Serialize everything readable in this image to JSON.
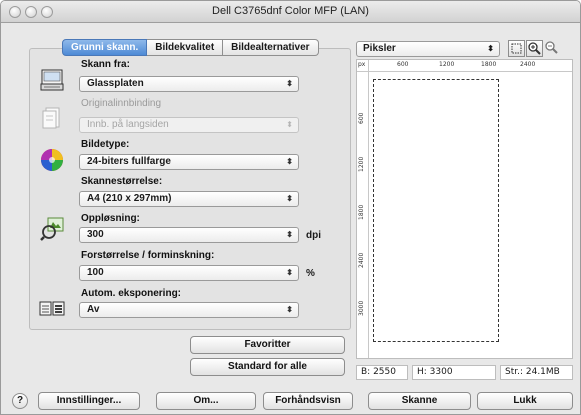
{
  "window": {
    "title": "Dell C3765dnf Color MFP (LAN)"
  },
  "tabs": [
    {
      "label": "Grunni skann."
    },
    {
      "label": "Bildekvalitet"
    },
    {
      "label": "Bildealternativer"
    }
  ],
  "scan_from": {
    "label": "Skann fra:",
    "value": "Glassplaten"
  },
  "binding": {
    "label": "Originalinnbinding",
    "value": "Innb. på langsiden"
  },
  "image_type": {
    "label": "Bildetype:",
    "value": "24-biters fullfarge"
  },
  "scan_size": {
    "label": "Skannestørrelse:",
    "value": "A4 (210 x 297mm)"
  },
  "resolution": {
    "label": "Oppløsning:",
    "value": "300",
    "unit": "dpi"
  },
  "scale": {
    "label": "Forstørrelse / forminskning:",
    "value": "100",
    "unit": "%"
  },
  "exposure": {
    "label": "Autom. eksponering:",
    "value": "Av"
  },
  "buttons": {
    "favorites": "Favoritter",
    "defaults": "Standard for alle",
    "settings": "Innstillinger...",
    "about": "Om...",
    "preview": "Forhåndsvisn",
    "scan": "Skanne",
    "close": "Lukk",
    "help": "?"
  },
  "preview": {
    "unit_select": "Piksler",
    "ruler_unit": "px",
    "ruler_x": [
      "600",
      "1200",
      "1800",
      "2400"
    ],
    "ruler_y": [
      "600",
      "1200",
      "1800",
      "2400",
      "3000"
    ]
  },
  "status": {
    "width": "B: 2550",
    "height": "H: 3300",
    "size": "Str.: 24.1MB"
  }
}
